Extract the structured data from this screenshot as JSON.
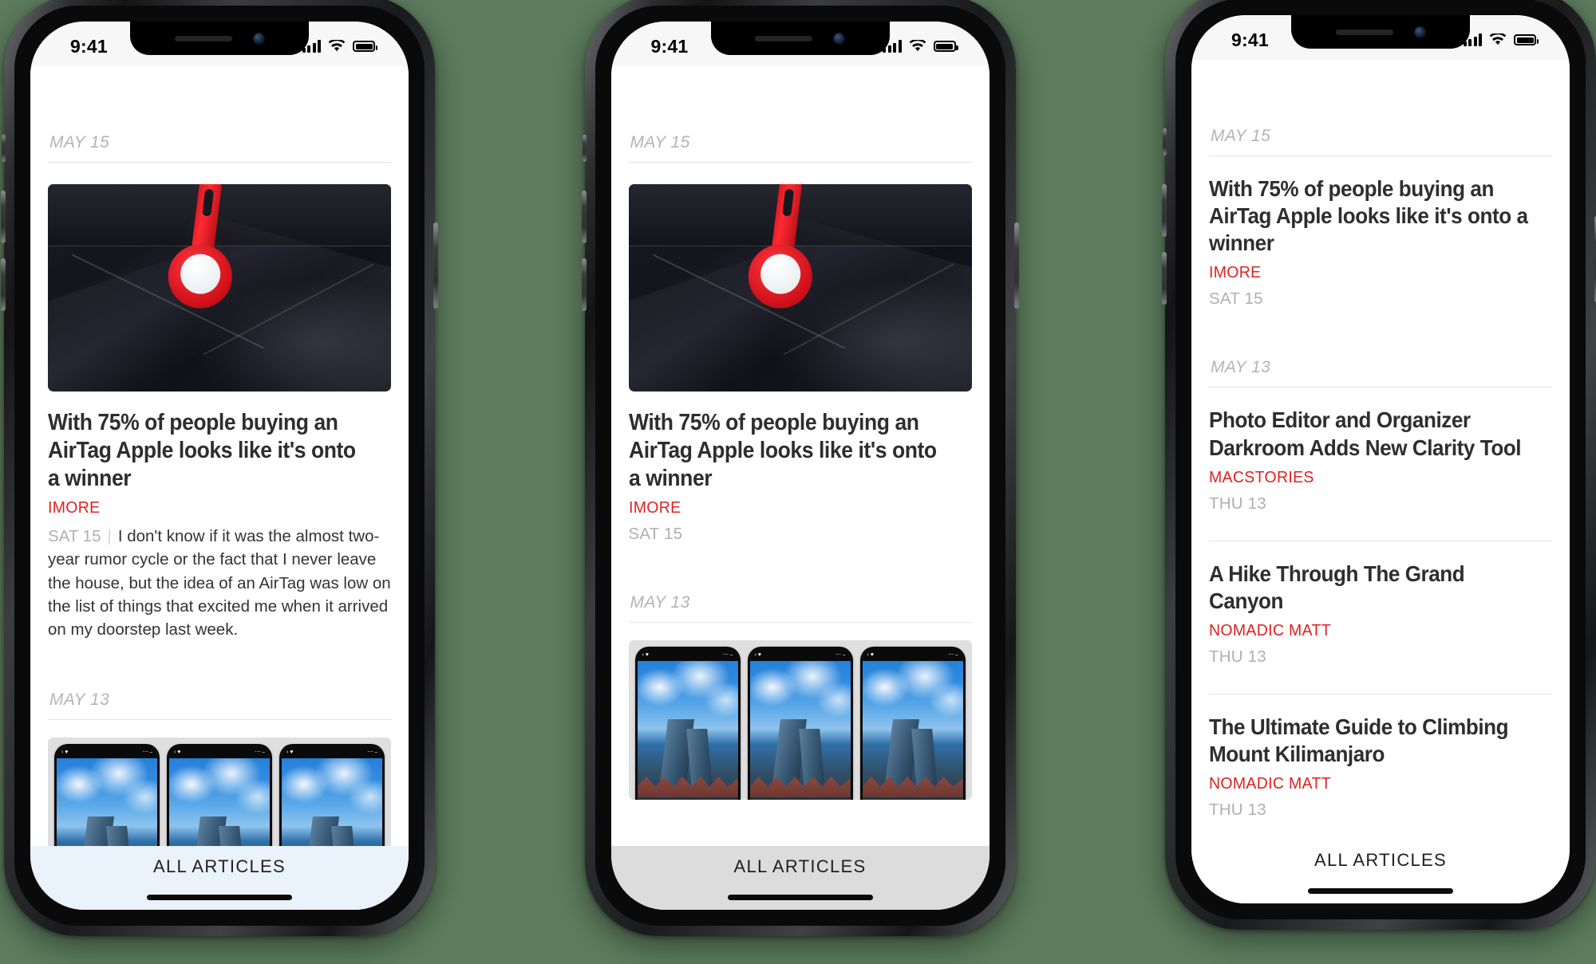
{
  "background_color": "#5d7d5e",
  "accent_color": "#e02020",
  "status_bar": {
    "time": "9:41",
    "cellular_icon": "cellular-bars-icon",
    "wifi_icon": "wifi-icon",
    "battery_icon": "battery-icon"
  },
  "tab_bar": {
    "label": "ALL ARTICLES",
    "home_indicator": "home-indicator"
  },
  "phones": [
    {
      "id": "phone-1",
      "tab_bar_tint": "#eaf2fb",
      "sections": [
        {
          "day": "MAY 15"
        }
      ],
      "featured": {
        "image_alt": "red-airtag-loop-on-black-bag",
        "headline": "With 75% of people buying an AirTag Apple looks like it's onto a winner",
        "source": "IMORE",
        "date": "SAT 15",
        "separator": "|",
        "excerpt": "I don't know if it was the almost two-year rumor cycle or the fact that I never leave the house, but the idea of an AirTag was low on the list of things that excited me when it arrived on my doorstep last week."
      },
      "next_day": "MAY 13",
      "thumbnail_strip_alt": "three-iphone-screenshots-city-skyline"
    },
    {
      "id": "phone-2",
      "tab_bar_tint": "#dcdcdc",
      "sections": [
        {
          "day": "MAY 15"
        }
      ],
      "featured": {
        "image_alt": "red-airtag-loop-on-black-bag",
        "headline": "With 75% of people buying an AirTag Apple looks like it's onto a winner",
        "source": "IMORE",
        "date": "SAT 15"
      },
      "next_day": "MAY 13",
      "thumbnail_strip_alt": "three-iphone-screenshots-city-skyline"
    },
    {
      "id": "phone-3",
      "tab_bar_tint": "#ffffff",
      "groups": [
        {
          "day": "MAY 15",
          "articles": [
            {
              "headline": "With 75% of people buying an AirTag Apple looks like it's onto a winner",
              "source": "IMORE",
              "date": "SAT 15"
            }
          ]
        },
        {
          "day": "MAY 13",
          "articles": [
            {
              "headline": "Photo Editor and Organizer Darkroom Adds New Clarity Tool",
              "source": "MACSTORIES",
              "date": "THU 13"
            },
            {
              "headline": "A Hike Through The Grand Canyon",
              "source": "NOMADIC MATT",
              "date": "THU 13"
            },
            {
              "headline": "The Ultimate Guide to Climbing Mount Kilimanjaro",
              "source": "NOMADIC MATT",
              "date": "THU 13"
            }
          ]
        }
      ]
    }
  ]
}
